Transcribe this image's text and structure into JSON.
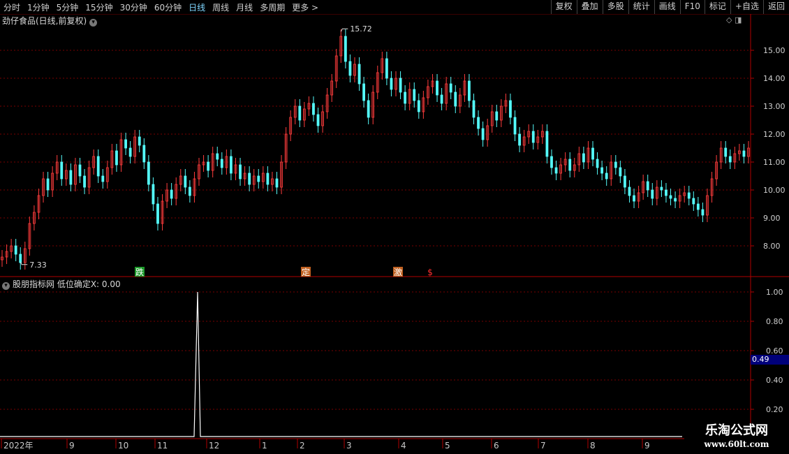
{
  "toolbar": {
    "periods": [
      "分时",
      "1分钟",
      "5分钟",
      "15分钟",
      "30分钟",
      "60分钟",
      "日线",
      "周线",
      "月线",
      "多周期",
      "更多 >"
    ],
    "active_period": "日线",
    "right_buttons": [
      "复权",
      "叠加",
      "多股",
      "统计",
      "画线",
      "F10",
      "标记",
      "+自选",
      "返回"
    ]
  },
  "main_title": "劲仔食品(日线,前复权)",
  "sub_title": "股朋指标网  低位确定X: 0.00",
  "price_axis": [
    "15.00",
    "14.00",
    "13.00",
    "12.00",
    "11.00",
    "10.00",
    "9.00",
    "8.00"
  ],
  "sub_axis": [
    "1.00",
    "0.80",
    "0.60",
    "0.40",
    "0.20"
  ],
  "current_value_label": "0.49",
  "high_label": "15.72",
  "low_label": "7.33",
  "signals": [
    {
      "text": "跌",
      "color": "#1d9a2a"
    },
    {
      "text": "定",
      "color": "#c06020"
    },
    {
      "text": "激",
      "color": "#c06020"
    },
    {
      "text": "$",
      "color": "#ff3030"
    }
  ],
  "date_axis": [
    "2022年",
    "9",
    "10",
    "11",
    "12",
    "1",
    "2",
    "3",
    "4",
    "5",
    "6",
    "7",
    "8",
    "9"
  ],
  "watermark": {
    "line1": "乐淘公式网",
    "line2": "www.60lt.com"
  },
  "colors": {
    "up": "#ff3c3c",
    "down": "#54fcfc",
    "grid": "#7a0000",
    "axis": "#b00000",
    "white": "#ffffff"
  },
  "chart_data": {
    "type": "candlestick",
    "y_range": [
      7.0,
      16.0
    ],
    "closes": [
      7.6,
      7.8,
      8.0,
      7.7,
      7.4,
      7.9,
      8.8,
      9.2,
      9.8,
      10.4,
      10.0,
      10.6,
      11.0,
      10.4,
      10.7,
      10.2,
      10.9,
      10.5,
      10.1,
      10.8,
      11.2,
      10.5,
      10.3,
      10.8,
      11.4,
      10.9,
      11.8,
      11.5,
      11.2,
      11.9,
      11.6,
      11.0,
      10.2,
      9.5,
      8.8,
      9.6,
      10.0,
      9.7,
      10.2,
      10.5,
      10.1,
      9.8,
      10.4,
      10.9,
      11.0,
      10.7,
      11.3,
      11.1,
      10.8,
      11.2,
      10.6,
      10.9,
      10.4,
      10.6,
      10.2,
      10.5,
      10.3,
      10.6,
      10.2,
      10.4,
      10.1,
      11.0,
      12.0,
      12.6,
      13.0,
      12.5,
      12.9,
      13.1,
      12.7,
      12.3,
      12.8,
      13.4,
      13.9,
      14.8,
      15.5,
      14.6,
      14.1,
      14.5,
      13.8,
      13.2,
      12.6,
      13.5,
      14.2,
      14.7,
      14.0,
      13.6,
      14.0,
      13.5,
      13.1,
      13.6,
      13.2,
      12.8,
      13.3,
      13.7,
      13.9,
      13.4,
      13.1,
      13.8,
      13.5,
      13.0,
      13.4,
      13.9,
      13.2,
      12.6,
      12.2,
      11.8,
      12.3,
      12.8,
      12.5,
      13.0,
      13.2,
      12.6,
      12.0,
      11.6,
      11.9,
      12.1,
      11.7,
      11.9,
      12.1,
      11.2,
      10.8,
      10.6,
      10.9,
      11.1,
      10.7,
      10.9,
      11.3,
      11.0,
      11.5,
      11.1,
      10.8,
      10.6,
      10.4,
      11.0,
      10.8,
      10.5,
      10.1,
      9.8,
      9.6,
      9.9,
      10.3,
      10.0,
      9.7,
      10.1,
      10.0,
      9.8,
      9.7,
      9.6,
      9.8,
      9.9,
      9.7,
      9.5,
      9.3,
      9.1,
      9.8,
      10.4,
      11.0,
      11.5,
      11.2,
      11.0,
      11.3,
      11.4,
      11.2,
      11.5
    ]
  },
  "spike": {
    "value": 1.0,
    "position_label": "12"
  }
}
